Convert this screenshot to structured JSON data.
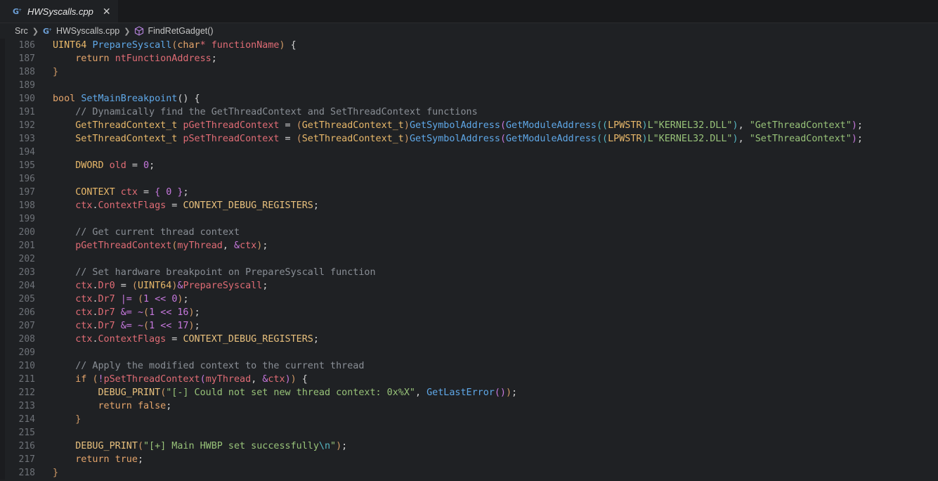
{
  "tab": {
    "label": "HWSyscalls.cpp",
    "close": "✕"
  },
  "breadcrumb": {
    "folder": "Src",
    "file": "HWSyscalls.cpp",
    "symbol": "FindRetGadget()"
  },
  "colors": {
    "background": "#1f2124",
    "keyword": "#e5a56b",
    "function": "#5fa8e8",
    "string": "#98c379",
    "comment": "#8a8f96",
    "variable": "#e06c75"
  },
  "lines": [
    {
      "n": "186",
      "tokens": [
        [
          "t-type",
          "UINT64 "
        ],
        [
          "t-fn",
          "PrepareSyscall"
        ],
        [
          "t-par",
          "("
        ],
        [
          "t-kw",
          "char"
        ],
        [
          "t-var",
          "* functionName"
        ],
        [
          "t-par",
          ")"
        ],
        [
          "t-plain",
          " {"
        ]
      ]
    },
    {
      "n": "187",
      "tokens": [
        [
          "t-plain",
          "    "
        ],
        [
          "t-kw",
          "return "
        ],
        [
          "t-var",
          "ntFunctionAddress"
        ],
        [
          "t-plain",
          ";"
        ]
      ]
    },
    {
      "n": "188",
      "tokens": [
        [
          "t-par",
          "}"
        ]
      ]
    },
    {
      "n": "189",
      "tokens": []
    },
    {
      "n": "190",
      "tokens": [
        [
          "t-kw",
          "bool "
        ],
        [
          "t-fn",
          "SetMainBreakpoint"
        ],
        [
          "t-plain",
          "() {"
        ]
      ]
    },
    {
      "n": "191",
      "tokens": [
        [
          "t-plain",
          "    "
        ],
        [
          "t-cmt",
          "// Dynamically find the GetThreadContext and SetThreadContext functions"
        ]
      ]
    },
    {
      "n": "192",
      "tokens": [
        [
          "t-plain",
          "    "
        ],
        [
          "t-type",
          "GetThreadContext_t "
        ],
        [
          "t-var",
          "pGetThreadContext"
        ],
        [
          "t-plain",
          " = "
        ],
        [
          "t-par",
          "("
        ],
        [
          "t-type",
          "GetThreadContext_t"
        ],
        [
          "t-par",
          ")"
        ],
        [
          "t-fn",
          "GetSymbolAddress"
        ],
        [
          "t-par2",
          "("
        ],
        [
          "t-fn",
          "GetModuleAddress"
        ],
        [
          "t-par3",
          "(("
        ],
        [
          "t-type",
          "LPWSTR"
        ],
        [
          "t-par3",
          ")"
        ],
        [
          "t-str",
          "L\"KERNEL32.DLL\""
        ],
        [
          "t-par3",
          ")"
        ],
        [
          "t-plain",
          ", "
        ],
        [
          "t-str",
          "\"GetThreadContext\""
        ],
        [
          "t-par2",
          ")"
        ],
        [
          "t-plain",
          ";"
        ]
      ]
    },
    {
      "n": "193",
      "tokens": [
        [
          "t-plain",
          "    "
        ],
        [
          "t-type",
          "SetThreadContext_t "
        ],
        [
          "t-var",
          "pSetThreadContext"
        ],
        [
          "t-plain",
          " = "
        ],
        [
          "t-par",
          "("
        ],
        [
          "t-type",
          "SetThreadContext_t"
        ],
        [
          "t-par",
          ")"
        ],
        [
          "t-fn",
          "GetSymbolAddress"
        ],
        [
          "t-par2",
          "("
        ],
        [
          "t-fn",
          "GetModuleAddress"
        ],
        [
          "t-par3",
          "(("
        ],
        [
          "t-type",
          "LPWSTR"
        ],
        [
          "t-par3",
          ")"
        ],
        [
          "t-str",
          "L\"KERNEL32.DLL\""
        ],
        [
          "t-par3",
          ")"
        ],
        [
          "t-plain",
          ", "
        ],
        [
          "t-str",
          "\"SetThreadContext\""
        ],
        [
          "t-par2",
          ")"
        ],
        [
          "t-plain",
          ";"
        ]
      ]
    },
    {
      "n": "194",
      "tokens": []
    },
    {
      "n": "195",
      "tokens": [
        [
          "t-plain",
          "    "
        ],
        [
          "t-type",
          "DWORD "
        ],
        [
          "t-var",
          "old"
        ],
        [
          "t-plain",
          " = "
        ],
        [
          "t-num",
          "0"
        ],
        [
          "t-plain",
          ";"
        ]
      ]
    },
    {
      "n": "196",
      "tokens": []
    },
    {
      "n": "197",
      "tokens": [
        [
          "t-plain",
          "    "
        ],
        [
          "t-type",
          "CONTEXT "
        ],
        [
          "t-var",
          "ctx"
        ],
        [
          "t-plain",
          " = "
        ],
        [
          "t-par2",
          "{ "
        ],
        [
          "t-num",
          "0"
        ],
        [
          "t-par2",
          " }"
        ],
        [
          "t-plain",
          ";"
        ]
      ]
    },
    {
      "n": "198",
      "tokens": [
        [
          "t-plain",
          "    "
        ],
        [
          "t-var",
          "ctx"
        ],
        [
          "t-plain",
          "."
        ],
        [
          "t-var",
          "ContextFlags"
        ],
        [
          "t-plain",
          " = "
        ],
        [
          "t-mac",
          "CONTEXT_DEBUG_REGISTERS"
        ],
        [
          "t-plain",
          ";"
        ]
      ]
    },
    {
      "n": "199",
      "tokens": []
    },
    {
      "n": "200",
      "tokens": [
        [
          "t-plain",
          "    "
        ],
        [
          "t-cmt",
          "// Get current thread context"
        ]
      ]
    },
    {
      "n": "201",
      "tokens": [
        [
          "t-plain",
          "    "
        ],
        [
          "t-var",
          "pGetThreadContext"
        ],
        [
          "t-par",
          "("
        ],
        [
          "t-var",
          "myThread"
        ],
        [
          "t-plain",
          ", "
        ],
        [
          "t-par2",
          "&"
        ],
        [
          "t-var",
          "ctx"
        ],
        [
          "t-par",
          ")"
        ],
        [
          "t-plain",
          ";"
        ]
      ]
    },
    {
      "n": "202",
      "tokens": []
    },
    {
      "n": "203",
      "tokens": [
        [
          "t-plain",
          "    "
        ],
        [
          "t-cmt",
          "// Set hardware breakpoint on PrepareSyscall function"
        ]
      ]
    },
    {
      "n": "204",
      "tokens": [
        [
          "t-plain",
          "    "
        ],
        [
          "t-var",
          "ctx"
        ],
        [
          "t-plain",
          "."
        ],
        [
          "t-var",
          "Dr0"
        ],
        [
          "t-plain",
          " = "
        ],
        [
          "t-par",
          "("
        ],
        [
          "t-type",
          "UINT64"
        ],
        [
          "t-par",
          ")"
        ],
        [
          "t-par2",
          "&"
        ],
        [
          "t-var",
          "PrepareSyscall"
        ],
        [
          "t-plain",
          ";"
        ]
      ]
    },
    {
      "n": "205",
      "tokens": [
        [
          "t-plain",
          "    "
        ],
        [
          "t-var",
          "ctx"
        ],
        [
          "t-plain",
          "."
        ],
        [
          "t-var",
          "Dr7"
        ],
        [
          "t-plain",
          " "
        ],
        [
          "t-par2",
          "|="
        ],
        [
          "t-plain",
          " "
        ],
        [
          "t-par",
          "("
        ],
        [
          "t-num",
          "1"
        ],
        [
          "t-plain",
          " "
        ],
        [
          "t-par2",
          "<<"
        ],
        [
          "t-plain",
          " "
        ],
        [
          "t-num",
          "0"
        ],
        [
          "t-par",
          ")"
        ],
        [
          "t-plain",
          ";"
        ]
      ]
    },
    {
      "n": "206",
      "tokens": [
        [
          "t-plain",
          "    "
        ],
        [
          "t-var",
          "ctx"
        ],
        [
          "t-plain",
          "."
        ],
        [
          "t-var",
          "Dr7"
        ],
        [
          "t-plain",
          " "
        ],
        [
          "t-par2",
          "&="
        ],
        [
          "t-plain",
          " "
        ],
        [
          "t-par2",
          "~"
        ],
        [
          "t-par",
          "("
        ],
        [
          "t-num",
          "1"
        ],
        [
          "t-plain",
          " "
        ],
        [
          "t-par2",
          "<<"
        ],
        [
          "t-plain",
          " "
        ],
        [
          "t-num",
          "16"
        ],
        [
          "t-par",
          ")"
        ],
        [
          "t-plain",
          ";"
        ]
      ]
    },
    {
      "n": "207",
      "tokens": [
        [
          "t-plain",
          "    "
        ],
        [
          "t-var",
          "ctx"
        ],
        [
          "t-plain",
          "."
        ],
        [
          "t-var",
          "Dr7"
        ],
        [
          "t-plain",
          " "
        ],
        [
          "t-par2",
          "&="
        ],
        [
          "t-plain",
          " "
        ],
        [
          "t-par2",
          "~"
        ],
        [
          "t-par",
          "("
        ],
        [
          "t-num",
          "1"
        ],
        [
          "t-plain",
          " "
        ],
        [
          "t-par2",
          "<<"
        ],
        [
          "t-plain",
          " "
        ],
        [
          "t-num",
          "17"
        ],
        [
          "t-par",
          ")"
        ],
        [
          "t-plain",
          ";"
        ]
      ]
    },
    {
      "n": "208",
      "tokens": [
        [
          "t-plain",
          "    "
        ],
        [
          "t-var",
          "ctx"
        ],
        [
          "t-plain",
          "."
        ],
        [
          "t-var",
          "ContextFlags"
        ],
        [
          "t-plain",
          " = "
        ],
        [
          "t-mac",
          "CONTEXT_DEBUG_REGISTERS"
        ],
        [
          "t-plain",
          ";"
        ]
      ]
    },
    {
      "n": "209",
      "tokens": []
    },
    {
      "n": "210",
      "tokens": [
        [
          "t-plain",
          "    "
        ],
        [
          "t-cmt",
          "// Apply the modified context to the current thread"
        ]
      ]
    },
    {
      "n": "211",
      "tokens": [
        [
          "t-plain",
          "    "
        ],
        [
          "t-kw",
          "if "
        ],
        [
          "t-par",
          "("
        ],
        [
          "t-par2",
          "!"
        ],
        [
          "t-var",
          "pSetThreadContext"
        ],
        [
          "t-par2",
          "("
        ],
        [
          "t-var",
          "myThread"
        ],
        [
          "t-plain",
          ", "
        ],
        [
          "t-par2",
          "&"
        ],
        [
          "t-var",
          "ctx"
        ],
        [
          "t-par2",
          ")"
        ],
        [
          "t-par",
          ")"
        ],
        [
          "t-plain",
          " {"
        ]
      ]
    },
    {
      "n": "212",
      "tokens": [
        [
          "t-plain",
          "        "
        ],
        [
          "t-mac",
          "DEBUG_PRINT"
        ],
        [
          "t-par",
          "("
        ],
        [
          "t-str",
          "\"[-] Could not set new thread context: 0x%X\""
        ],
        [
          "t-plain",
          ", "
        ],
        [
          "t-fn",
          "GetLastError"
        ],
        [
          "t-par2",
          "()"
        ],
        [
          "t-par",
          ")"
        ],
        [
          "t-plain",
          ";"
        ]
      ]
    },
    {
      "n": "213",
      "tokens": [
        [
          "t-plain",
          "        "
        ],
        [
          "t-kw",
          "return "
        ],
        [
          "t-kw",
          "false"
        ],
        [
          "t-plain",
          ";"
        ]
      ]
    },
    {
      "n": "214",
      "tokens": [
        [
          "t-plain",
          "    "
        ],
        [
          "t-par",
          "}"
        ]
      ]
    },
    {
      "n": "215",
      "tokens": []
    },
    {
      "n": "216",
      "tokens": [
        [
          "t-plain",
          "    "
        ],
        [
          "t-mac",
          "DEBUG_PRINT"
        ],
        [
          "t-par",
          "("
        ],
        [
          "t-str",
          "\"[+] Main HWBP set successfully"
        ],
        [
          "t-esc",
          "\\n"
        ],
        [
          "t-str",
          "\""
        ],
        [
          "t-par",
          ")"
        ],
        [
          "t-plain",
          ";"
        ]
      ]
    },
    {
      "n": "217",
      "tokens": [
        [
          "t-plain",
          "    "
        ],
        [
          "t-kw",
          "return "
        ],
        [
          "t-kw",
          "true"
        ],
        [
          "t-plain",
          ";"
        ]
      ]
    },
    {
      "n": "218",
      "tokens": [
        [
          "t-par",
          "}"
        ]
      ]
    }
  ]
}
